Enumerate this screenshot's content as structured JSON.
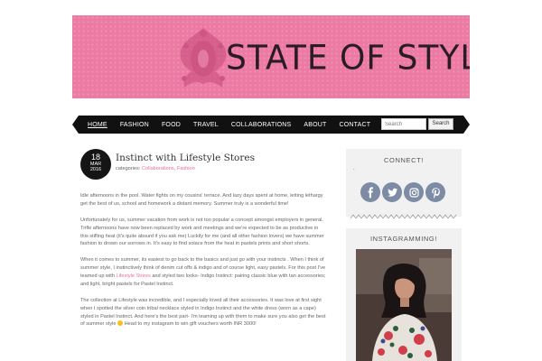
{
  "banner": {
    "title": "STATE OF STYLE",
    "background": "#ec7aa3"
  },
  "nav": {
    "items": [
      "HOME",
      "FASHION",
      "FOOD",
      "TRAVEL",
      "COLLABORATIONS",
      "ABOUT",
      "CONTACT"
    ],
    "active_index": 0,
    "search_placeholder": "Search",
    "search_button": "Search"
  },
  "post": {
    "date": {
      "day": "18",
      "month": "MAR",
      "year": "2016"
    },
    "title": "Instinct with Lifestyle Stores",
    "categories_label": "categories:",
    "categories": [
      "Collaborations",
      "Fashion"
    ],
    "paragraphs": [
      "Idle afternoons in the pool. Water fights on my cousins' terrace. And lazy days spent at home, letting lethargy get the best of us, school and homework a distant memory. Summer truly is a wonderful time!",
      "Unfortunately for us, summer vacation from work is not too popular a concept amongst employers in general. Trifle afternoons have now been replaced by work and meetings and we're expected to be as productive in this stifling heat (it's quite absurd if you ask me) Luckily for me (and all other fashion lovers) we have summer fashion to drown our sorrows in. It's easy to find solace from the heat in pastels prints and short shorts.",
      "When it comes to summer, its easiest to go back to the basics and just go with your instincts . When I think of summer style, I instinctively think of denim cut offs & indigo and of course light, easy pastels. For this post I've teamed up with",
      "The collection at Lifestyle was incredible, and I especially loved all their accessories. It was love at first sight when I spotted the silver coin tribal necklace styled in Indigo Instinct and the white dress (worn as a cape) styled in Pastel Instinct. And here's the best part- I'm teaming up with them to make sure you also get the best of summer style"
    ],
    "p3_link": "Lifestyle Stores",
    "p3_rest": "and styled two looks- Indigo Instinct: pairing classic blue with tan accessories; and light, bright pastels for Pastel Instinct.",
    "p4_rest": "Head to my instagram to win gift vouchers worth INR 3000!"
  },
  "sidebar": {
    "connect_title": "CONNECT!",
    "connect_dot": ".",
    "social_icons": [
      "facebook-icon",
      "twitter-icon",
      "instagram-icon",
      "pinterest-icon"
    ],
    "social_color": "#7d8ca4",
    "instagram_title": "INSTAGRAMMING!"
  },
  "colors": {
    "accent": "#e86f98",
    "nav_bg": "#111111",
    "sidebar_bg": "#f1f1f1"
  }
}
